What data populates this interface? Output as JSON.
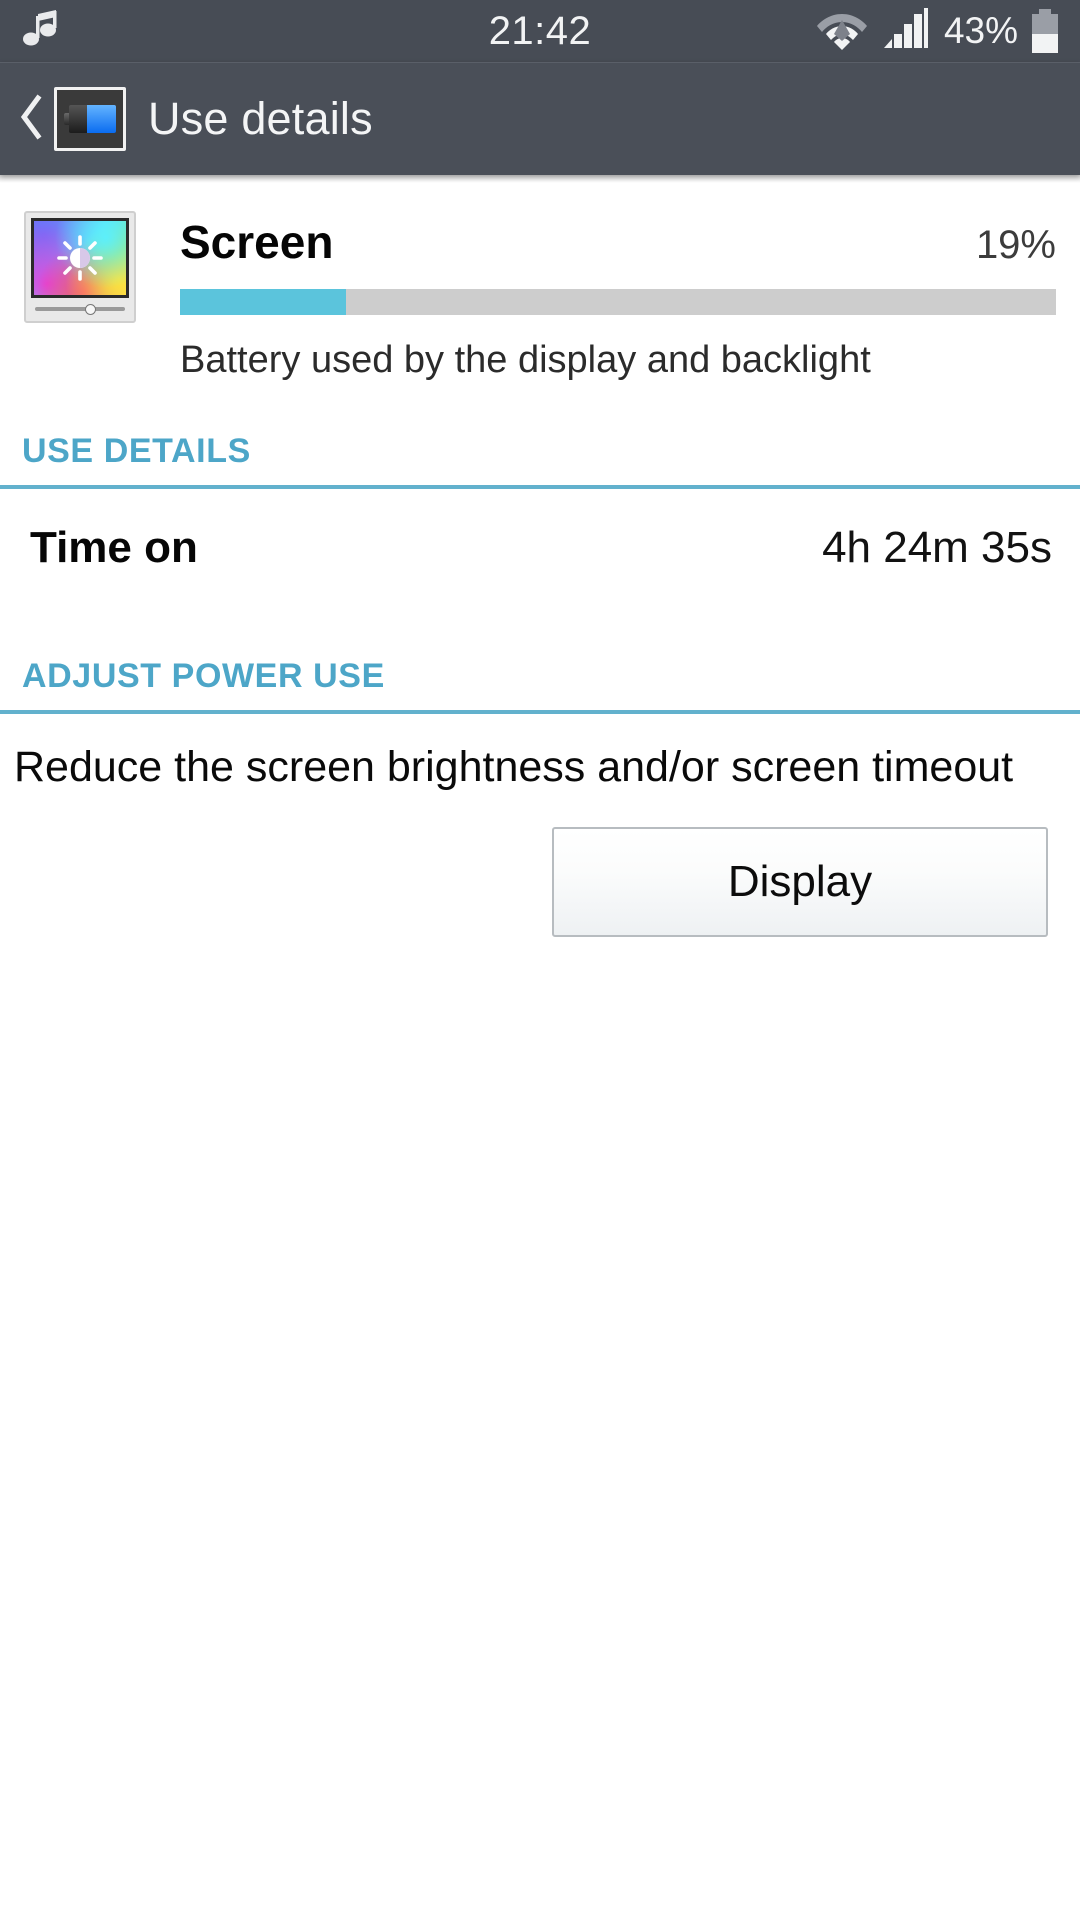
{
  "status_bar": {
    "music_icon": "music-note-icon",
    "clock": "21:42",
    "wifi_icon": "wifi-icon",
    "signal_icon": "cellular-signal-icon",
    "battery_percent": "43%",
    "battery_icon": "battery-icon",
    "background_color": "#474C55"
  },
  "action_bar": {
    "back_icon": "back-chevron-icon",
    "app_icon": "battery-app-icon",
    "title": "Use details",
    "background_color": "#4A4F58"
  },
  "entry": {
    "icon": "screen-brightness-icon",
    "title": "Screen",
    "percent_label": "19%",
    "percent_value": 19,
    "description": "Battery used by the display and backlight",
    "bar_fill_color": "#5BC4DC",
    "bar_track_color": "#CDCDCD"
  },
  "use_details": {
    "header": "USE DETAILS",
    "rows": [
      {
        "label": "Time on",
        "value": "4h 24m 35s"
      }
    ]
  },
  "adjust_power_use": {
    "header": "ADJUST POWER USE",
    "advice": "Reduce the screen brightness and/or screen timeout",
    "button_label": "Display"
  },
  "accent_color": "#4DA6C8"
}
